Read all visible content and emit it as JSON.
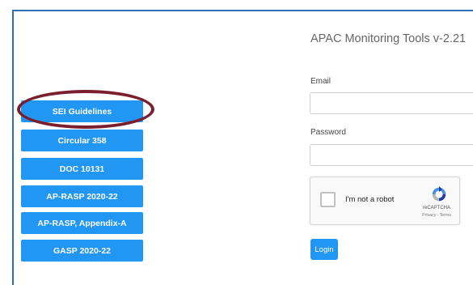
{
  "sidebar": {
    "buttons": [
      {
        "label": "SEI Guidelines"
      },
      {
        "label": "Circular 358"
      },
      {
        "label": "DOC 10131"
      },
      {
        "label": "AP-RASP 2020-22"
      },
      {
        "label": "AP-RASP, Appendix-A"
      },
      {
        "label": "GASP 2020-22"
      }
    ]
  },
  "login_form": {
    "title": "APAC Monitoring Tools v-2.21",
    "email_label": "Email",
    "email_value": "",
    "password_label": "Password",
    "password_value": "",
    "captcha": {
      "checkbox_label": "I'm not a robot",
      "brand": "reCAPTCHA",
      "terms": "Privacy - Terms"
    },
    "login_label": "Login"
  },
  "colors": {
    "button_blue": "#2196f3",
    "highlight_ellipse": "#7a1f2e",
    "frame_border": "#2e6fb5"
  }
}
